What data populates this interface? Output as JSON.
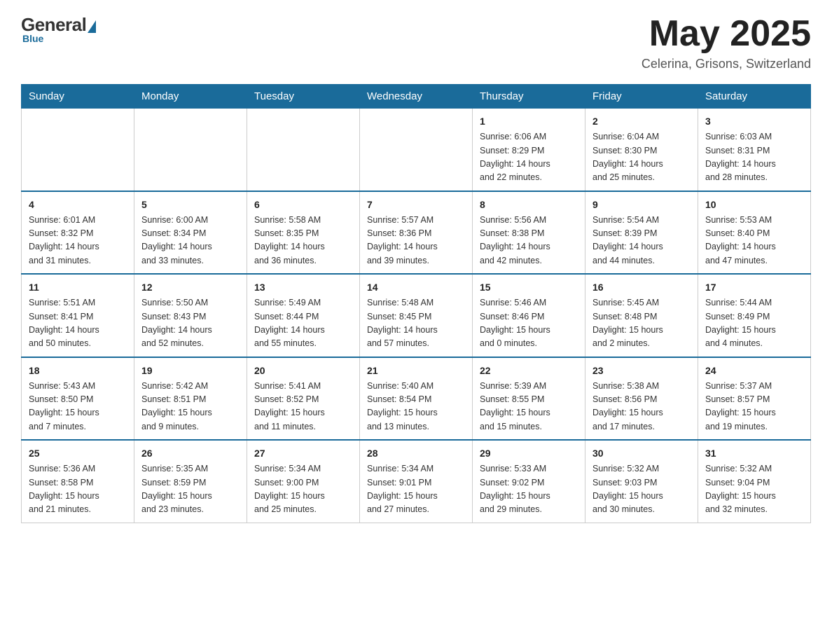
{
  "header": {
    "logo_general": "General",
    "logo_blue": "Blue",
    "month_title": "May 2025",
    "location": "Celerina, Grisons, Switzerland"
  },
  "weekdays": [
    "Sunday",
    "Monday",
    "Tuesday",
    "Wednesday",
    "Thursday",
    "Friday",
    "Saturday"
  ],
  "weeks": [
    [
      {
        "day": "",
        "info": ""
      },
      {
        "day": "",
        "info": ""
      },
      {
        "day": "",
        "info": ""
      },
      {
        "day": "",
        "info": ""
      },
      {
        "day": "1",
        "info": "Sunrise: 6:06 AM\nSunset: 8:29 PM\nDaylight: 14 hours\nand 22 minutes."
      },
      {
        "day": "2",
        "info": "Sunrise: 6:04 AM\nSunset: 8:30 PM\nDaylight: 14 hours\nand 25 minutes."
      },
      {
        "day": "3",
        "info": "Sunrise: 6:03 AM\nSunset: 8:31 PM\nDaylight: 14 hours\nand 28 minutes."
      }
    ],
    [
      {
        "day": "4",
        "info": "Sunrise: 6:01 AM\nSunset: 8:32 PM\nDaylight: 14 hours\nand 31 minutes."
      },
      {
        "day": "5",
        "info": "Sunrise: 6:00 AM\nSunset: 8:34 PM\nDaylight: 14 hours\nand 33 minutes."
      },
      {
        "day": "6",
        "info": "Sunrise: 5:58 AM\nSunset: 8:35 PM\nDaylight: 14 hours\nand 36 minutes."
      },
      {
        "day": "7",
        "info": "Sunrise: 5:57 AM\nSunset: 8:36 PM\nDaylight: 14 hours\nand 39 minutes."
      },
      {
        "day": "8",
        "info": "Sunrise: 5:56 AM\nSunset: 8:38 PM\nDaylight: 14 hours\nand 42 minutes."
      },
      {
        "day": "9",
        "info": "Sunrise: 5:54 AM\nSunset: 8:39 PM\nDaylight: 14 hours\nand 44 minutes."
      },
      {
        "day": "10",
        "info": "Sunrise: 5:53 AM\nSunset: 8:40 PM\nDaylight: 14 hours\nand 47 minutes."
      }
    ],
    [
      {
        "day": "11",
        "info": "Sunrise: 5:51 AM\nSunset: 8:41 PM\nDaylight: 14 hours\nand 50 minutes."
      },
      {
        "day": "12",
        "info": "Sunrise: 5:50 AM\nSunset: 8:43 PM\nDaylight: 14 hours\nand 52 minutes."
      },
      {
        "day": "13",
        "info": "Sunrise: 5:49 AM\nSunset: 8:44 PM\nDaylight: 14 hours\nand 55 minutes."
      },
      {
        "day": "14",
        "info": "Sunrise: 5:48 AM\nSunset: 8:45 PM\nDaylight: 14 hours\nand 57 minutes."
      },
      {
        "day": "15",
        "info": "Sunrise: 5:46 AM\nSunset: 8:46 PM\nDaylight: 15 hours\nand 0 minutes."
      },
      {
        "day": "16",
        "info": "Sunrise: 5:45 AM\nSunset: 8:48 PM\nDaylight: 15 hours\nand 2 minutes."
      },
      {
        "day": "17",
        "info": "Sunrise: 5:44 AM\nSunset: 8:49 PM\nDaylight: 15 hours\nand 4 minutes."
      }
    ],
    [
      {
        "day": "18",
        "info": "Sunrise: 5:43 AM\nSunset: 8:50 PM\nDaylight: 15 hours\nand 7 minutes."
      },
      {
        "day": "19",
        "info": "Sunrise: 5:42 AM\nSunset: 8:51 PM\nDaylight: 15 hours\nand 9 minutes."
      },
      {
        "day": "20",
        "info": "Sunrise: 5:41 AM\nSunset: 8:52 PM\nDaylight: 15 hours\nand 11 minutes."
      },
      {
        "day": "21",
        "info": "Sunrise: 5:40 AM\nSunset: 8:54 PM\nDaylight: 15 hours\nand 13 minutes."
      },
      {
        "day": "22",
        "info": "Sunrise: 5:39 AM\nSunset: 8:55 PM\nDaylight: 15 hours\nand 15 minutes."
      },
      {
        "day": "23",
        "info": "Sunrise: 5:38 AM\nSunset: 8:56 PM\nDaylight: 15 hours\nand 17 minutes."
      },
      {
        "day": "24",
        "info": "Sunrise: 5:37 AM\nSunset: 8:57 PM\nDaylight: 15 hours\nand 19 minutes."
      }
    ],
    [
      {
        "day": "25",
        "info": "Sunrise: 5:36 AM\nSunset: 8:58 PM\nDaylight: 15 hours\nand 21 minutes."
      },
      {
        "day": "26",
        "info": "Sunrise: 5:35 AM\nSunset: 8:59 PM\nDaylight: 15 hours\nand 23 minutes."
      },
      {
        "day": "27",
        "info": "Sunrise: 5:34 AM\nSunset: 9:00 PM\nDaylight: 15 hours\nand 25 minutes."
      },
      {
        "day": "28",
        "info": "Sunrise: 5:34 AM\nSunset: 9:01 PM\nDaylight: 15 hours\nand 27 minutes."
      },
      {
        "day": "29",
        "info": "Sunrise: 5:33 AM\nSunset: 9:02 PM\nDaylight: 15 hours\nand 29 minutes."
      },
      {
        "day": "30",
        "info": "Sunrise: 5:32 AM\nSunset: 9:03 PM\nDaylight: 15 hours\nand 30 minutes."
      },
      {
        "day": "31",
        "info": "Sunrise: 5:32 AM\nSunset: 9:04 PM\nDaylight: 15 hours\nand 32 minutes."
      }
    ]
  ]
}
